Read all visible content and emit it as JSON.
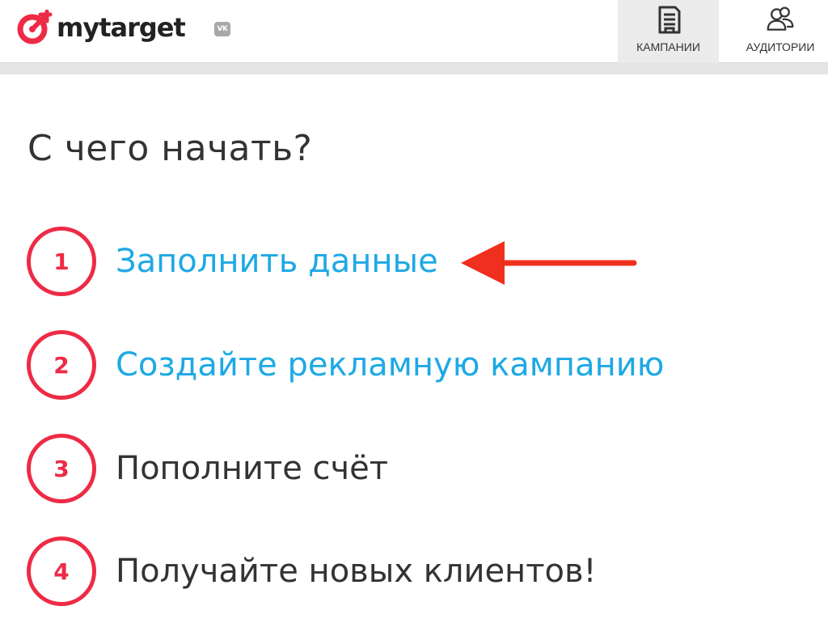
{
  "header": {
    "logo_text": "mytarget",
    "vk_badge": "VK",
    "tabs": [
      {
        "label": "КАМПАНИИ",
        "icon": "document-icon",
        "active": true
      },
      {
        "label": "АУДИТОРИИ",
        "icon": "users-icon",
        "active": false
      }
    ]
  },
  "main": {
    "title": "С чего начать?",
    "steps": [
      {
        "number": "1",
        "text": "Заполнить данные",
        "is_link": true
      },
      {
        "number": "2",
        "text": "Создайте рекламную кампанию",
        "is_link": true
      },
      {
        "number": "3",
        "text": "Пополните счёт",
        "is_link": false
      },
      {
        "number": "4",
        "text": "Получайте новых клиентов!",
        "is_link": false
      }
    ]
  },
  "colors": {
    "brand_red": "#ee2b46",
    "link_blue": "#1ea9e4",
    "arrow_red": "#f0301e",
    "text_dark": "#333333"
  }
}
